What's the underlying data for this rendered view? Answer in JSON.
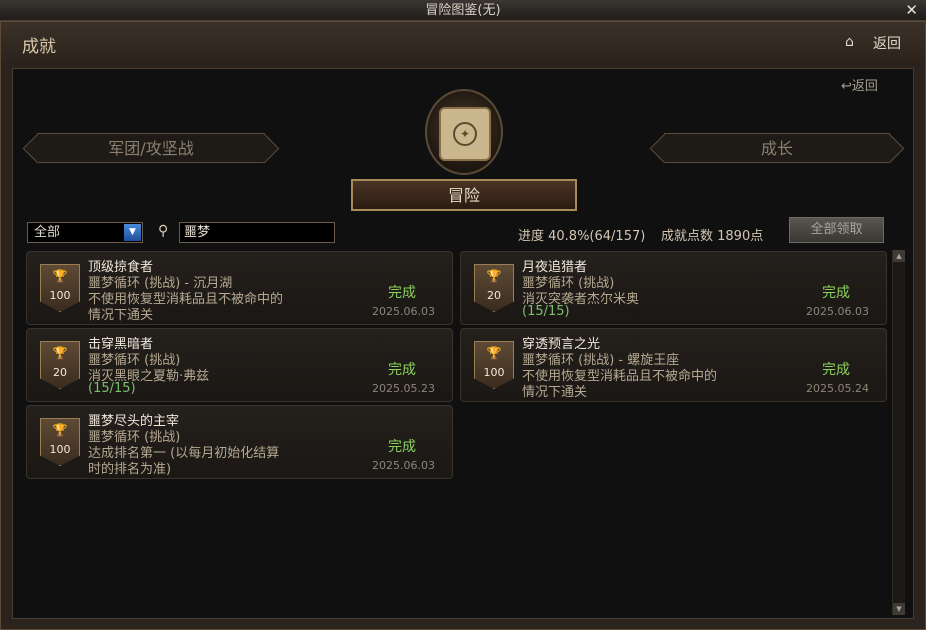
{
  "window": {
    "title": "冒险图鉴(无)",
    "close": "✕"
  },
  "header": {
    "title": "成就",
    "back": "返回"
  },
  "panel": {
    "back": "返回"
  },
  "tabs": {
    "left": "军团/攻坚战",
    "main": "冒险",
    "right": "成长"
  },
  "filter": {
    "selected": "全部"
  },
  "search": {
    "value": "噩梦"
  },
  "stats": {
    "progress": "进度 40.8%(64/157)",
    "points": "成就点数 1890点"
  },
  "claim_all": "全部领取",
  "achievements": [
    {
      "points": "100",
      "name": "顶级掠食者",
      "line1": "噩梦循环 (挑战) - 沉月湖",
      "line2": "不使用恢复型消耗品且不被命中的",
      "line3": "情况下通关",
      "status": "完成",
      "date": "2025.06.03"
    },
    {
      "points": "20",
      "name": "月夜追猎者",
      "line1": "噩梦循环 (挑战)",
      "line2": "消灭突袭者杰尔米奥",
      "line3": "(15/15)",
      "status": "完成",
      "date": "2025.06.03"
    },
    {
      "points": "20",
      "name": "击穿黑暗者",
      "line1": "噩梦循环 (挑战)",
      "line2": "消灭黑眼之夏勒·弗兹",
      "line3": "(15/15)",
      "status": "完成",
      "date": "2025.05.23"
    },
    {
      "points": "100",
      "name": "穿透预言之光",
      "line1": "噩梦循环 (挑战) - 螺旋王座",
      "line2": "不使用恢复型消耗品且不被命中的",
      "line3": "情况下通关",
      "status": "完成",
      "date": "2025.05.24"
    },
    {
      "points": "100",
      "name": "噩梦尽头的主宰",
      "line1": "噩梦循环 (挑战)",
      "line2": "达成排名第一 (以每月初始化结算",
      "line3": "时的排名为准)",
      "status": "完成",
      "date": "2025.06.03"
    }
  ]
}
